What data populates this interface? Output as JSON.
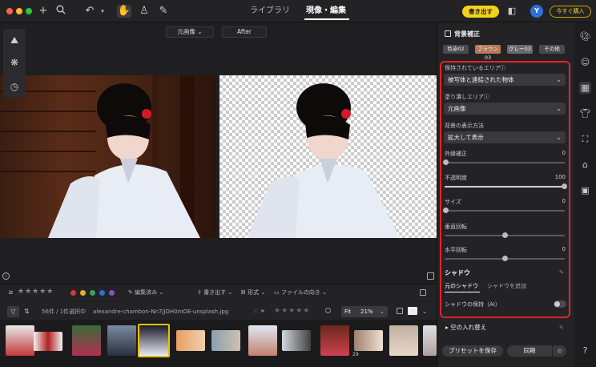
{
  "topbar": {
    "tab_library": "ライブラリ",
    "tab_develop": "現像・編集",
    "export_button": "書き出す",
    "avatar_letter": "Y",
    "buy_button": "今すぐ購入"
  },
  "canvas": {
    "view_select": "元画像",
    "after_label": "After"
  },
  "strip": {
    "edited": "編集済み",
    "export": "書き出す",
    "format": "形式",
    "file_orientation": "ファイルの向き",
    "count": "56件 / 1件選択中",
    "filename": "alexandre-chambon-Nn7JjDH0mOE-unsplash.jpg",
    "fit": "Fit",
    "zoom": "21%",
    "badge_29": "29"
  },
  "panel": {
    "title": "背景補正",
    "presets": [
      "色染02",
      "ブラウン03",
      "グレー03",
      "その他"
    ],
    "kept_area_label": "保持されているエリア",
    "kept_area_value": "被写体と連結された物体",
    "fill_area_label": "塗り潰しエリア",
    "fill_area_value": "元画像",
    "display_method_label": "背景の表示方法",
    "display_method_value": "拡大して表示",
    "sliders": [
      {
        "label": "外縁補正",
        "value": "0"
      },
      {
        "label": "不透明度",
        "value": "100"
      },
      {
        "label": "サイズ",
        "value": "0"
      },
      {
        "label": "垂直回転",
        "value": ""
      },
      {
        "label": "水平回転",
        "value": "0"
      }
    ],
    "shadow_title": "シャドウ",
    "shadow_tab_original": "元のシャドウ",
    "shadow_tab_add": "シャドウを追加",
    "shadow_keep": "シャドウの保持（AI）",
    "sky_replace": "空の入れ替え",
    "save_preset": "プリセットを保存",
    "sync": "同期"
  },
  "colors": {
    "accent_yellow": "#f5d21a",
    "highlight_red": "#e0242a"
  }
}
